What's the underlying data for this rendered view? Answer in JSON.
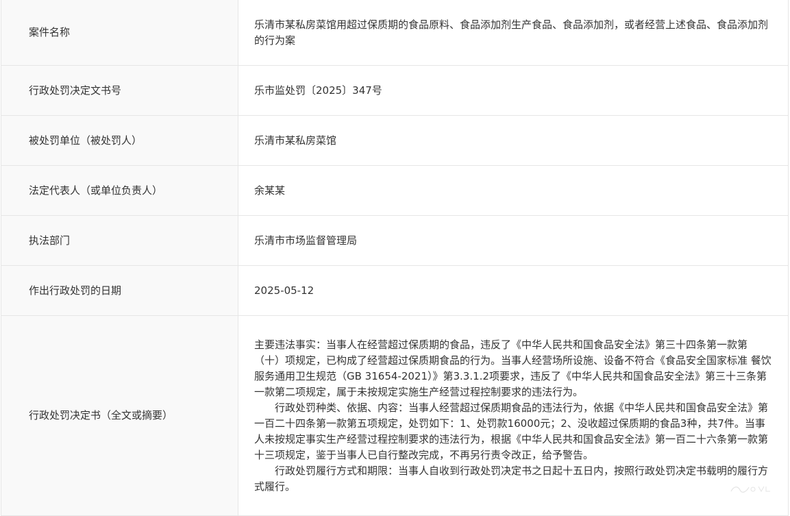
{
  "rows": [
    {
      "label": "案件名称",
      "value": "乐清市某私房菜馆用超过保质期的食品原料、食品添加剂生产食品、食品添加剂，或者经营上述食品、食品添加剂的行为案"
    },
    {
      "label": "行政处罚决定文书号",
      "value": "乐市监处罚〔2025〕347号"
    },
    {
      "label": "被处罚单位（被处罚人）",
      "value": "乐清市某私房菜馆"
    },
    {
      "label": "法定代表人（或单位负责人）",
      "value": "余某某"
    },
    {
      "label": "执法部门",
      "value": "乐清市市场监督管理局"
    },
    {
      "label": "作出行政处罚的日期",
      "value": "2025-05-12"
    }
  ],
  "decision": {
    "label": "行政处罚决定书（全文或摘要）",
    "paragraphs": [
      "主要违法事实：当事人在经营超过保质期的食品，违反了《中华人民共和国食品安全法》第三十四条第一款第（十）项规定，已构成了经营超过保质期食品的行为。当事人经营场所设施、设备不符合《食品安全国家标准 餐饮服务通用卫生规范（GB 31654-2021）》第3.3.1.2项要求，违反了《中华人民共和国食品安全法》第三十三条第一款第二项规定，属于未按规定实施生产经营过程控制要求的违法行为。",
      "行政处罚种类、依据、内容：当事人经营超过保质期食品的违法行为，依据《中华人民共和国食品安全法》第一百二十四条第一款第五项规定，处罚如下：1、处罚款16000元；2、没收超过保质期的食品3种，共7件。当事人未按规定事实生产经营过程控制要求的违法行为，根据《中华人民共和国食品安全法》第一百二十六条第一款第十三项规定，鉴于当事人已自行整改完成，不再另行责令改正，给予警告。",
      "行政处罚履行方式和期限：当事人自收到行政处罚决定书之日起十五日内，按照行政处罚决定书载明的履行方式履行。"
    ]
  }
}
